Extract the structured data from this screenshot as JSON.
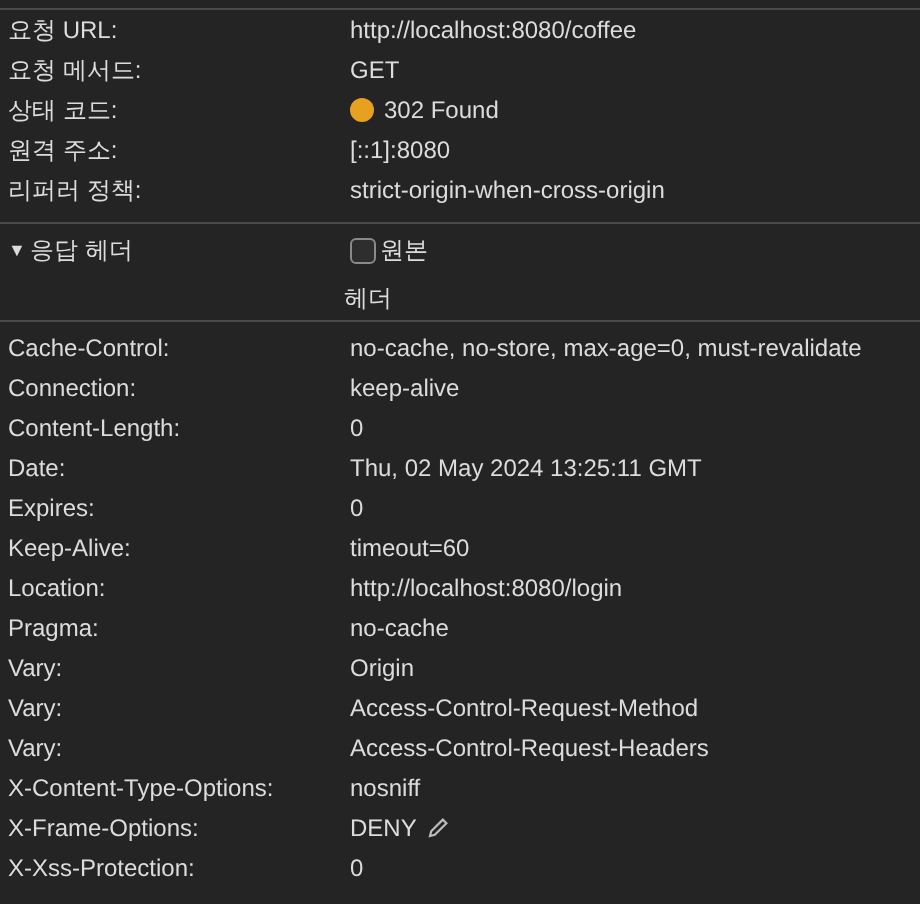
{
  "general": [
    {
      "label": "요청 URL:",
      "value": "http://localhost:8080/coffee"
    },
    {
      "label": "요청 메서드:",
      "value": "GET"
    },
    {
      "label": "상태 코드:",
      "value": "302 Found",
      "color": "#e8a020"
    },
    {
      "label": "원격 주소:",
      "value": "[::1]:8080"
    },
    {
      "label": "리퍼러 정책:",
      "value": "strict-origin-when-cross-origin"
    }
  ],
  "response_headers": {
    "title": "응답 헤더",
    "caret": "▼",
    "expanded": true,
    "toggle": {
      "label": "원본",
      "checked": false
    },
    "column_title": "헤더",
    "rows": [
      {
        "name": "Cache-Control:",
        "value": "no-cache, no-store, max-age=0, must-revalidate",
        "editable": false
      },
      {
        "name": "Connection:",
        "value": "keep-alive",
        "editable": false
      },
      {
        "name": "Content-Length:",
        "value": "0",
        "editable": false
      },
      {
        "name": "Date:",
        "value": "Thu, 02 May 2024 13:25:11 GMT",
        "editable": false
      },
      {
        "name": "Expires:",
        "value": "0",
        "editable": false
      },
      {
        "name": "Keep-Alive:",
        "value": "timeout=60",
        "editable": false
      },
      {
        "name": "Location:",
        "value": "http://localhost:8080/login",
        "editable": false
      },
      {
        "name": "Pragma:",
        "value": "no-cache",
        "editable": false
      },
      {
        "name": "Vary:",
        "value": "Origin",
        "editable": false
      },
      {
        "name": "Vary:",
        "value": "Access-Control-Request-Method",
        "editable": false
      },
      {
        "name": "Vary:",
        "value": "Access-Control-Request-Headers",
        "editable": false
      },
      {
        "name": "X-Content-Type-Options:",
        "value": "nosniff",
        "editable": false
      },
      {
        "name": "X-Frame-Options:",
        "value": "DENY",
        "editable": true
      },
      {
        "name": "X-Xss-Protection:",
        "value": "0",
        "editable": false
      }
    ]
  }
}
